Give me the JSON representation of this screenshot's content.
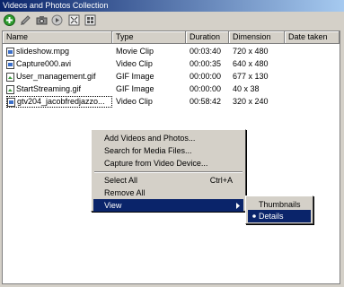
{
  "window": {
    "title": "Videos and Photos Collection"
  },
  "toolbar": {
    "icons": [
      "add-icon",
      "edit-icon",
      "camera-icon",
      "play-icon",
      "fit-icon",
      "grid-icon"
    ]
  },
  "columns": [
    "Name",
    "Type",
    "Duration",
    "Dimension",
    "Date taken"
  ],
  "rows": [
    {
      "name": "slideshow.mpg",
      "type": "Movie Clip",
      "duration": "00:03:40",
      "dimension": "720 x 480"
    },
    {
      "name": "Capture000.avi",
      "type": "Video Clip",
      "duration": "00:00:35",
      "dimension": "640 x 480"
    },
    {
      "name": "User_management.gif",
      "type": "GIF Image",
      "duration": "00:00:00",
      "dimension": "677 x 130"
    },
    {
      "name": "StartStreaming.gif",
      "type": "GIF Image",
      "duration": "00:00:00",
      "dimension": "40 x 38"
    },
    {
      "name": "gtv204_jacobfredjazzo...",
      "type": "Video Clip",
      "duration": "00:58:42",
      "dimension": "320 x 240"
    }
  ],
  "context_menu": {
    "add": "Add Videos and Photos...",
    "search": "Search for Media Files...",
    "capture": "Capture from Video Device...",
    "select_all": "Select All",
    "select_all_shortcut": "Ctrl+A",
    "remove_all": "Remove All",
    "view": "View"
  },
  "submenu": {
    "thumbnails": "Thumbnails",
    "details": "Details",
    "selected": "Details"
  }
}
